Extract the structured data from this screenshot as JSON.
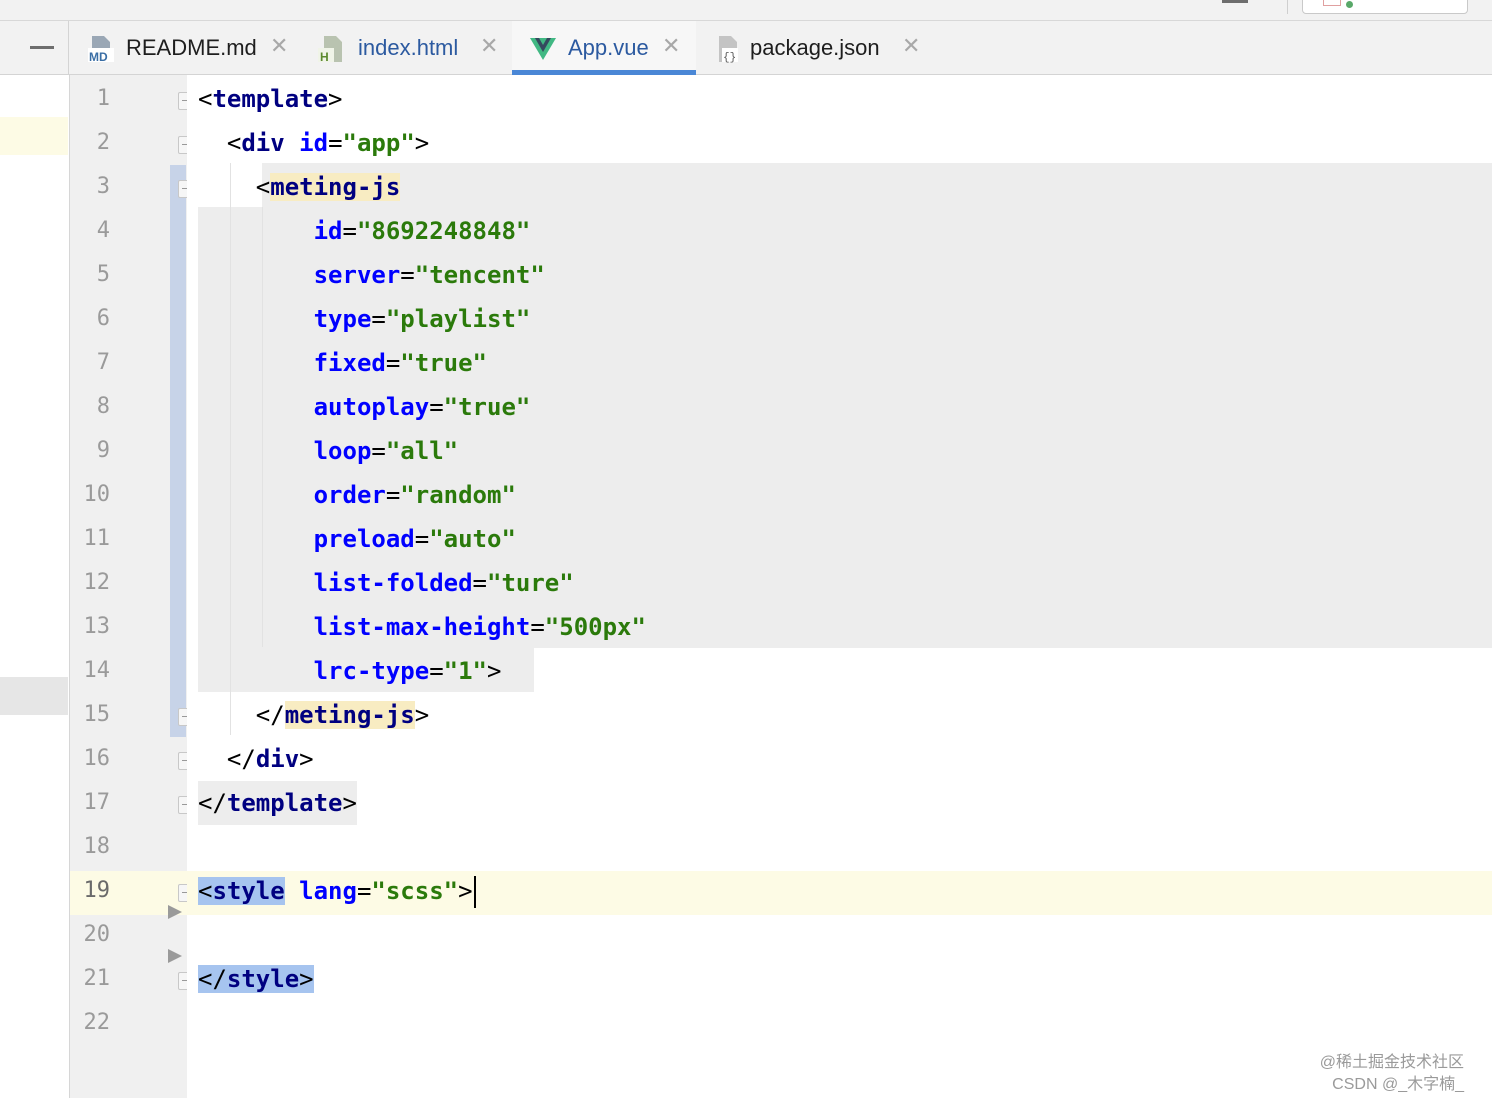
{
  "tabs": [
    {
      "label": "README.md",
      "icon": "markdown-file-icon",
      "badge": "MD",
      "active": false
    },
    {
      "label": "index.html",
      "icon": "html-file-icon",
      "badge": "H",
      "active": false
    },
    {
      "label": "App.vue",
      "icon": "vue-file-icon",
      "badge": "V",
      "active": true
    },
    {
      "label": "package.json",
      "icon": "json-file-icon",
      "badge": "{}",
      "active": false
    }
  ],
  "close_glyph": "✕",
  "line_numbers": [
    "1",
    "2",
    "3",
    "4",
    "5",
    "6",
    "7",
    "8",
    "9",
    "10",
    "11",
    "12",
    "13",
    "14",
    "15",
    "16",
    "17",
    "18",
    "19",
    "20",
    "21",
    "22"
  ],
  "current_line": "19",
  "code": {
    "l1": {
      "open": "<",
      "tag": "template",
      "close": ">"
    },
    "l2": {
      "open": "<",
      "tag": "div",
      "attr": "id",
      "eq": "=",
      "val": "\"app\"",
      "close": ">"
    },
    "l3": {
      "open": "<",
      "tag": "meting-js"
    },
    "l4": {
      "attr": "id",
      "eq": "=",
      "val": "\"8692248848\""
    },
    "l5": {
      "attr": "server",
      "eq": "=",
      "val": "\"tencent\""
    },
    "l6": {
      "attr": "type",
      "eq": "=",
      "val": "\"playlist\""
    },
    "l7": {
      "attr": "fixed",
      "eq": "=",
      "val": "\"true\""
    },
    "l8": {
      "attr": "autoplay",
      "eq": "=",
      "val": "\"true\""
    },
    "l9": {
      "attr": "loop",
      "eq": "=",
      "val": "\"all\""
    },
    "l10": {
      "attr": "order",
      "eq": "=",
      "val": "\"random\""
    },
    "l11": {
      "attr": "preload",
      "eq": "=",
      "val": "\"auto\""
    },
    "l12": {
      "attr": "list-folded",
      "eq": "=",
      "val": "\"ture\""
    },
    "l13": {
      "attr": "list-max-height",
      "eq": "=",
      "val": "\"500px\""
    },
    "l14": {
      "attr": "lrc-type",
      "eq": "=",
      "val": "\"1\"",
      "close": ">"
    },
    "l15": {
      "open": "</",
      "tag": "meting-js",
      "close": ">"
    },
    "l16": {
      "open": "</",
      "tag": "div",
      "close": ">"
    },
    "l17": {
      "open": "</",
      "tag": "template",
      "close": ">"
    },
    "l19": {
      "open": "<",
      "tag": "style",
      "attr": "lang",
      "eq": "=",
      "val": "\"scss\"",
      "close": ">"
    },
    "l21": {
      "open": "</",
      "tag": "style",
      "close": ">"
    }
  },
  "watermark": {
    "line1": "@稀土掘金技术社区",
    "line2": "CSDN @_木字楠_"
  },
  "colors": {
    "tag": "#000080",
    "attr": "#0000ff",
    "value": "#2b7a0b",
    "active_tab_underline": "#4a87d6",
    "current_line": "#fdfbe5",
    "selection": "#a6c4ef",
    "tag_match": "#f8ecc2"
  }
}
